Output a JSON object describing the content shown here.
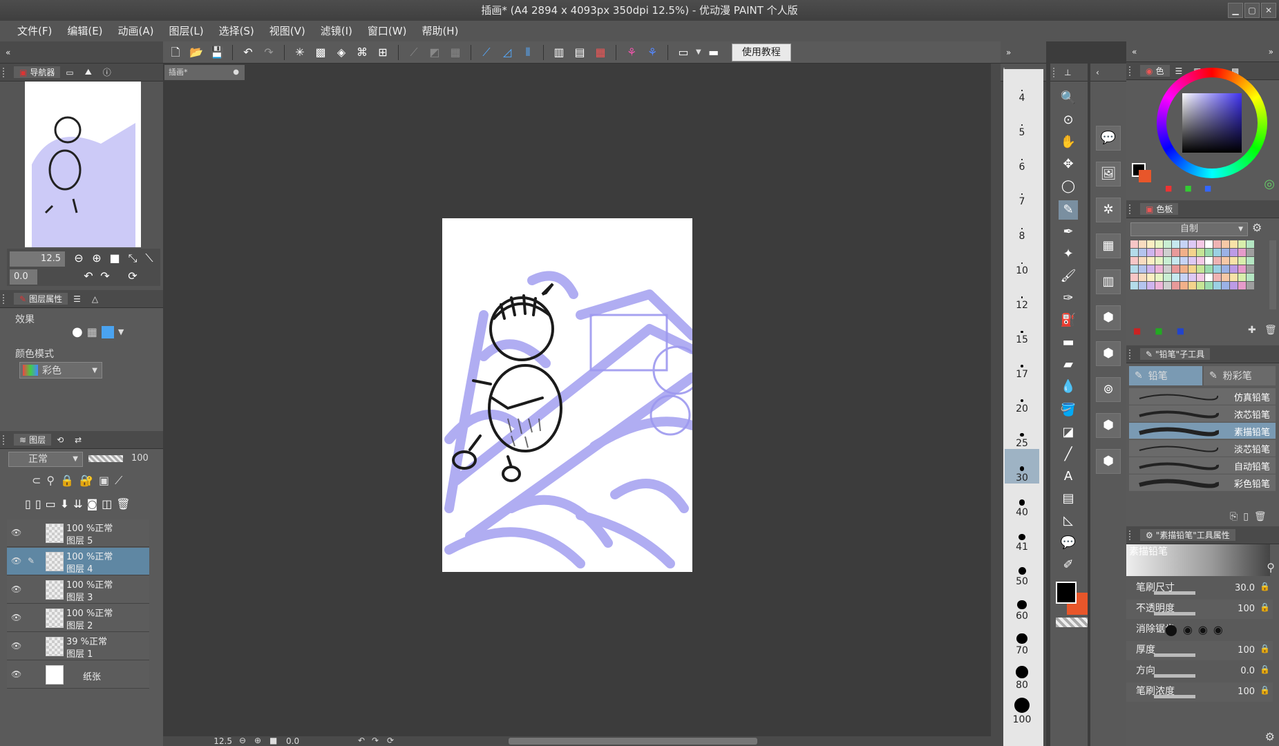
{
  "title": "插画* (A4 2894 x 4093px 350dpi 12.5%) - 优动漫 PAINT 个人版",
  "menu": [
    "文件(F)",
    "编辑(E)",
    "动画(A)",
    "图层(L)",
    "选择(S)",
    "视图(V)",
    "滤镜(I)",
    "窗口(W)",
    "帮助(H)"
  ],
  "toolbar": {
    "tutorial_label": "使用教程"
  },
  "navigator": {
    "tab": "导航器",
    "zoom": "12.5",
    "rotate": "0.0"
  },
  "layer_props": {
    "tab": "图层属性",
    "effect_label": "效果",
    "color_mode_label": "颜色模式",
    "color_mode_value": "彩色"
  },
  "layers_panel": {
    "tab": "图层",
    "blend": "正常",
    "opacity": "100",
    "items": [
      {
        "pct": "100 %正常",
        "name": "图层 5",
        "selected": false
      },
      {
        "pct": "100 %正常",
        "name": "图层 4",
        "selected": true
      },
      {
        "pct": "100 %正常",
        "name": "图层 3",
        "selected": false
      },
      {
        "pct": "100 %正常",
        "name": "图层 2",
        "selected": false
      },
      {
        "pct": "39 %正常",
        "name": "图层 1",
        "selected": false
      },
      {
        "pct": "",
        "name": "纸张",
        "selected": false
      }
    ]
  },
  "document": {
    "tab": "插画*",
    "zoom": "12.5",
    "rotate": "0.0"
  },
  "brush_sizes": [
    "4",
    "5",
    "6",
    "7",
    "8",
    "10",
    "12",
    "15",
    "17",
    "20",
    "25",
    "30",
    "40",
    "41",
    "50",
    "60",
    "70",
    "80",
    "100"
  ],
  "brush_selected": "30",
  "color_panel": {
    "tab": "色"
  },
  "palette": {
    "tab": "色板",
    "set": "自制"
  },
  "subtool": {
    "tab": "\"铅笔\"子工具",
    "group1": "铅笔",
    "group2": "粉彩笔",
    "items": [
      "仿真铅笔",
      "浓芯铅笔",
      "素描铅笔",
      "淡芯铅笔",
      "自动铅笔",
      "彩色铅笔"
    ],
    "selected": "素描铅笔"
  },
  "tool_props": {
    "tab": "\"素描铅笔\"工具属性",
    "name": "素描铅笔",
    "rows": [
      {
        "label": "笔刷尺寸",
        "value": "30.0"
      },
      {
        "label": "不透明度",
        "value": "100"
      },
      {
        "label": "消除锯齿",
        "value": ""
      },
      {
        "label": "厚度",
        "value": "100"
      },
      {
        "label": "方向",
        "value": "0.0"
      },
      {
        "label": "笔刷浓度",
        "value": "100"
      }
    ]
  },
  "colors": {
    "main": "#000000",
    "sub": "#e8562a",
    "accent": "#5f87a3"
  }
}
